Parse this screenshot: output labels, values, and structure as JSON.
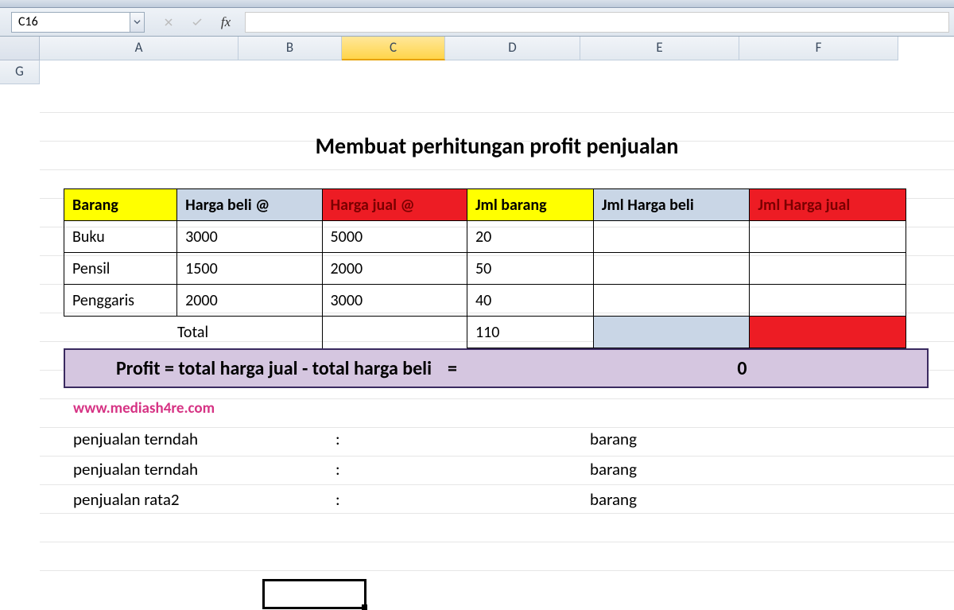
{
  "name_box": "C16",
  "fx_label": "fx",
  "columns": [
    "A",
    "B",
    "C",
    "D",
    "E",
    "F",
    "G"
  ],
  "active_column": "C",
  "title": "Membuat perhitungan profit penjualan",
  "headers": {
    "barang": "Barang",
    "harga_beli": "Harga beli @",
    "harga_jual": "Harga jual @",
    "jml_barang": "Jml barang",
    "jml_harga_beli": "Jml Harga beli",
    "jml_harga_jual": "Jml Harga jual"
  },
  "rows": [
    {
      "barang": "Buku",
      "beli": "3000",
      "jual": "5000",
      "jml": "20"
    },
    {
      "barang": "Pensil",
      "beli": "1500",
      "jual": "2000",
      "jml": "50"
    },
    {
      "barang": "Penggaris",
      "beli": "2000",
      "jual": "3000",
      "jml": "40"
    }
  ],
  "total_label": "Total",
  "total_jml": "110",
  "profit": {
    "label": "Profit = total harga jual - total harga beli",
    "equals": "=",
    "value": "0"
  },
  "link": "www.mediash4re.com",
  "stats": [
    {
      "label": "penjualan terndah",
      "colon": ":",
      "unit": "barang"
    },
    {
      "label": "penjualan terndah",
      "colon": ":",
      "unit": "barang"
    },
    {
      "label": "penjualan rata2",
      "colon": ":",
      "unit": "barang"
    }
  ]
}
